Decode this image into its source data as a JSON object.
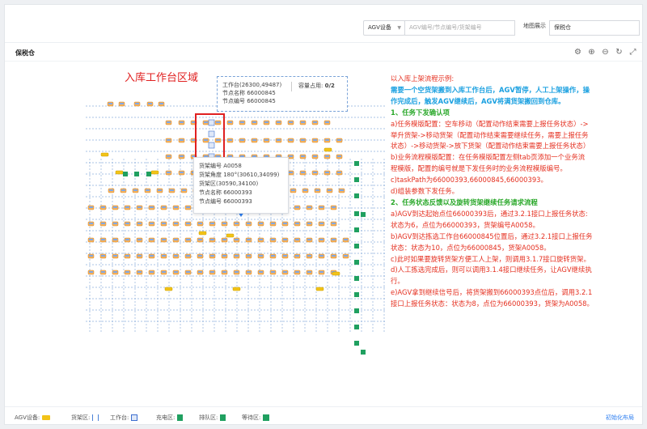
{
  "header": {
    "device_select": "AGV设备",
    "search_placeholder": "AGV编号/节点编号/货架编号",
    "map_label": "地图展示",
    "map_select": "保税仓"
  },
  "warehouse": {
    "title": "保税仓"
  },
  "toolbar": {
    "icons": [
      "settings-icon",
      "zoom-in-icon",
      "zoom-out-icon",
      "refresh-icon",
      "fullscreen-icon"
    ],
    "glyphs": [
      "⚙",
      "⊕",
      "⊖",
      "↻",
      "⤢"
    ]
  },
  "annotation_title": "入库工作台区域",
  "tooltip_workstation": {
    "line1": "工作台(26300,49487)",
    "line2": "节点名称 66000845",
    "line3": "节点编号 66000845",
    "capacity_label": "容量占用: ",
    "capacity_value": "0/2"
  },
  "tooltip_shelf": {
    "line1": "货架编号 A0058",
    "line2": "货架角度 180°(30610,34099)",
    "line3": "货架区(30590,34100)",
    "line4": "节点名称 66000393",
    "line5": "节点编号 66000393"
  },
  "annotation": {
    "l1": "以入库上架流程示例:",
    "l2": "需要一个空货架搬到入库工作台后，AGV暂停，人工上架操作，操",
    "l3": "作完成后，触发AGV继续后，AGV将满货架搬回到仓库。",
    "l4": "1、任务下发确认项",
    "l5": "a)任务模版配置：空车移动（配置动作结束需要上报任务状态）->",
    "l6": "举升货架->移动货架（配置动作结束需要继续任务，需要上报任务",
    "l7": "状态）->移动货架->放下货架（配置动作结束需要上报任务状态）",
    "l8": "b)业务流程模版配置：在任务模版配置左侧tab页添加一个业务流",
    "l9": "程模版，配置的编号就是下发任务时的业务流程模版编号。",
    "l10": "c)taskPath为66000393,66000845,66000393。",
    "l11": "d)组装参数下发任务。",
    "l12": "2、任务状态反馈以及旋转货架继续任务请求流程",
    "l13": "a)AGV到达起始点位66000393后，通过3.2.1接口上报任务状态:",
    "l14": "状态为6，点位为66000393，货架编号A0058。",
    "l15": "b)AGV到达拣选工作台66000845位置后，通过3.2.1接口上报任务",
    "l16": "状态：状态为10，点位为66000845，货架A0058。",
    "l17": "c)此时如果要旋转货架方便工人上架，则调用3.1.7接口旋转货架。",
    "l18": "d)人工拣选完成后，则可以调用3.1.4接口继续任务，让AGV继续执",
    "l19": "行。",
    "l20": "e)AGV拿到继续信号后，将货架搬到66000393点位后，调用3.2.1",
    "l21": "接口上报任务状态：状态为8，点位为66000393，货架为A0058。"
  },
  "legend": [
    {
      "label": "AGV设备:",
      "icon": "agv-icon",
      "color": "#f2c318"
    },
    {
      "label": "货架区:",
      "icon": "shelf-zone-icon",
      "color": "#4a82d8"
    },
    {
      "label": "工作台:",
      "icon": "workstation-icon",
      "color": "#3d6fd0"
    },
    {
      "label": "充电区:",
      "icon": "charging-icon",
      "color": "#20a060"
    },
    {
      "label": "排队区:",
      "icon": "queue-icon",
      "color": "#20a060"
    },
    {
      "label": "等待区:",
      "icon": "waiting-icon",
      "color": "#20a060"
    }
  ],
  "reset_label": "初始化布局",
  "colors": {
    "accent": "#2d7ef0",
    "annotation_red": "#e53020",
    "annotation_blue": "#1aa0e0",
    "annotation_green": "#2aa82a",
    "shelf_orange": "#f0a040",
    "agv_yellow": "#f2c318"
  }
}
